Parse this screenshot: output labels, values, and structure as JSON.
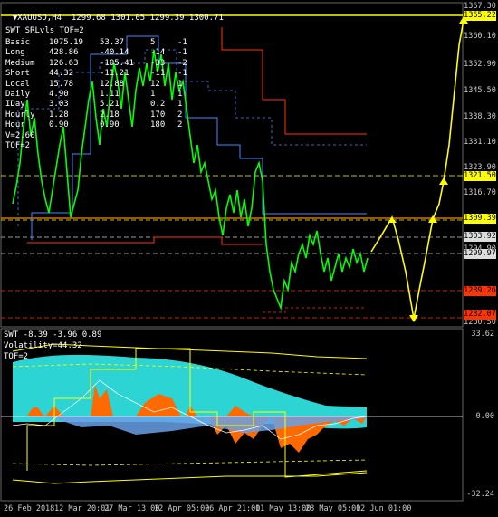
{
  "header": {
    "arrow": "▼",
    "symbol": "XAUUSD,H4",
    "ohlc": "1299.68 1301.05 1299.39 1300.71"
  },
  "indicator_title": "SWT_SRLvls_TOF=2",
  "levels_table": [
    [
      "Basic",
      "1075.19",
      "53.37",
      "5",
      "-1"
    ],
    [
      "Long",
      "428.86",
      "-40.14",
      "-14",
      "-1"
    ],
    [
      "Medium",
      "126.63",
      "-105.41",
      "-33",
      "-2"
    ],
    [
      "Short",
      "44.32",
      "-11.21",
      "-11",
      "-1"
    ],
    [
      "Local",
      "15.78",
      "12.88",
      "12",
      "1"
    ],
    [
      "Daily",
      "4.90",
      "1.11",
      "1",
      "1"
    ],
    [
      "IDay",
      "3.03",
      "5.21",
      "0.2",
      "1"
    ],
    [
      "Hourly",
      "1.28",
      "2.18",
      "170",
      "2"
    ],
    [
      "Hour",
      "0.90",
      "0.90",
      "180",
      "2"
    ]
  ],
  "v_line": "V=2.60",
  "tof_line": "TOF=2",
  "price_scale": [
    "1367.30",
    "1360.10",
    "1352.90",
    "1345.50",
    "1338.30",
    "1331.10",
    "1323.90",
    "1316.70",
    "1302.50",
    "1294.90",
    "1287.50",
    "1280.50"
  ],
  "price_tags": [
    {
      "text": "1365.22",
      "color": "#ffff00"
    },
    {
      "text": "1321.50",
      "color": "#ffff00"
    },
    {
      "text": "1309.39",
      "color": "#ffff00"
    },
    {
      "text": "1303.92",
      "color": "#dddddd"
    },
    {
      "text": "1299.97",
      "color": "#dddddd"
    },
    {
      "text": "1289.26",
      "color": "#ff3300"
    },
    {
      "text": "1282.07",
      "color": "#ff3300"
    }
  ],
  "oscillator": {
    "title": "SWT -8.39 -3.96 0.89",
    "volatility": "Volatility=44.32",
    "tof": "TOF=2",
    "scale": [
      "33.62",
      "0.00",
      "-32.24"
    ]
  },
  "x_axis": [
    "26 Feb 2018",
    "12 Mar 20:01",
    "27 Mar 13:00",
    "12 Apr 05:00",
    "26 Apr 21:00",
    "11 May 13:00",
    "28 May 05:00",
    "12 Jun 01:00"
  ],
  "colors": {
    "candles": "#00ff00",
    "forecast": "#ffff00",
    "support": "#ff3300",
    "resistance": "#4488ff",
    "cyan": "#2dd4d4",
    "orange": "#ff6a00",
    "grid": "#444444"
  }
}
